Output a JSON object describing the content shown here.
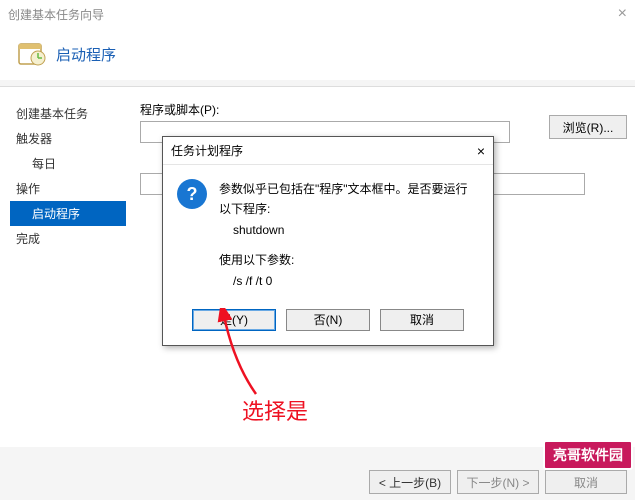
{
  "window": {
    "title": "创建基本任务向导",
    "close_glyph": "×"
  },
  "header": {
    "title": "启动程序"
  },
  "sidebar": {
    "items": [
      {
        "label": "创建基本任务"
      },
      {
        "label": "触发器"
      },
      {
        "label": "每日"
      },
      {
        "label": "操作"
      },
      {
        "label": "启动程序"
      },
      {
        "label": "完成"
      }
    ]
  },
  "main": {
    "script_label": "程序或脚本(P):",
    "browse_label": "浏览(R)..."
  },
  "dialog": {
    "title": "任务计划程序",
    "msg_line1": "参数似乎已包括在\"程序\"文本框中。是否要运行以下程序:",
    "msg_line2": "shutdown",
    "msg_line3": "使用以下参数:",
    "msg_line4": "/s /f /t 0",
    "yes": "是(Y)",
    "no": "否(N)",
    "cancel": "取消"
  },
  "footer": {
    "prev": "< 上一步(B)",
    "next": "下一步(N) >",
    "cancel": "取消"
  },
  "annotation": {
    "text": "选择是"
  },
  "watermark": {
    "text": "亮哥软件园"
  }
}
